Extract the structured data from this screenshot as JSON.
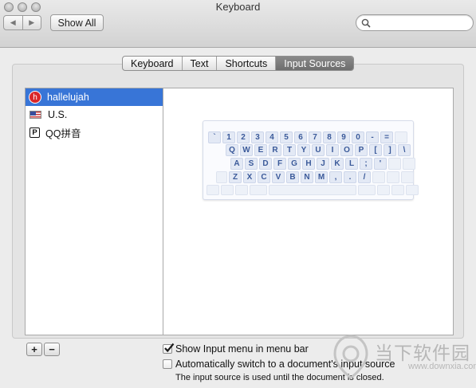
{
  "window": {
    "title": "Keyboard"
  },
  "toolbar": {
    "back_label": "◀",
    "forward_label": "▶",
    "show_all_label": "Show All",
    "search_placeholder": ""
  },
  "tabs": [
    {
      "label": "Keyboard",
      "selected": false
    },
    {
      "label": "Text",
      "selected": false
    },
    {
      "label": "Shortcuts",
      "selected": false
    },
    {
      "label": "Input Sources",
      "selected": true
    }
  ],
  "sources": [
    {
      "label": "hallelujah",
      "icon": "hallelujah-icon",
      "icon_text": "h",
      "selected": true
    },
    {
      "label": "U.S.",
      "icon": "us-flag-icon",
      "selected": false
    },
    {
      "label": "QQ拼音",
      "icon": "qq-pinyin-icon",
      "icon_text": "P",
      "selected": false
    }
  ],
  "keyboard": {
    "rows": [
      [
        "`",
        "1",
        "2",
        "3",
        "4",
        "5",
        "6",
        "7",
        "8",
        "9",
        "0",
        "-",
        "="
      ],
      [
        "Q",
        "W",
        "E",
        "R",
        "T",
        "Y",
        "U",
        "I",
        "O",
        "P",
        "[",
        "]",
        "\\"
      ],
      [
        "A",
        "S",
        "D",
        "F",
        "G",
        "H",
        "J",
        "K",
        "L",
        ";",
        "'"
      ],
      [
        "Z",
        "X",
        "C",
        "V",
        "B",
        "N",
        "M",
        ",",
        ".",
        "/"
      ]
    ]
  },
  "list_buttons": {
    "add_label": "+",
    "remove_label": "−"
  },
  "options": {
    "show_input_menu": {
      "label": "Show Input menu in menu bar",
      "checked": true
    },
    "auto_switch": {
      "label": "Automatically switch to a document's input source",
      "checked": false
    },
    "note": "The input source is used until the document is closed."
  },
  "watermark": {
    "text": "当下软件园",
    "url": "www.downxia.com"
  },
  "colors": {
    "selection": "#3875d7",
    "hallelujah_icon": "#d9262a",
    "watermark": "#b7b7b7"
  }
}
